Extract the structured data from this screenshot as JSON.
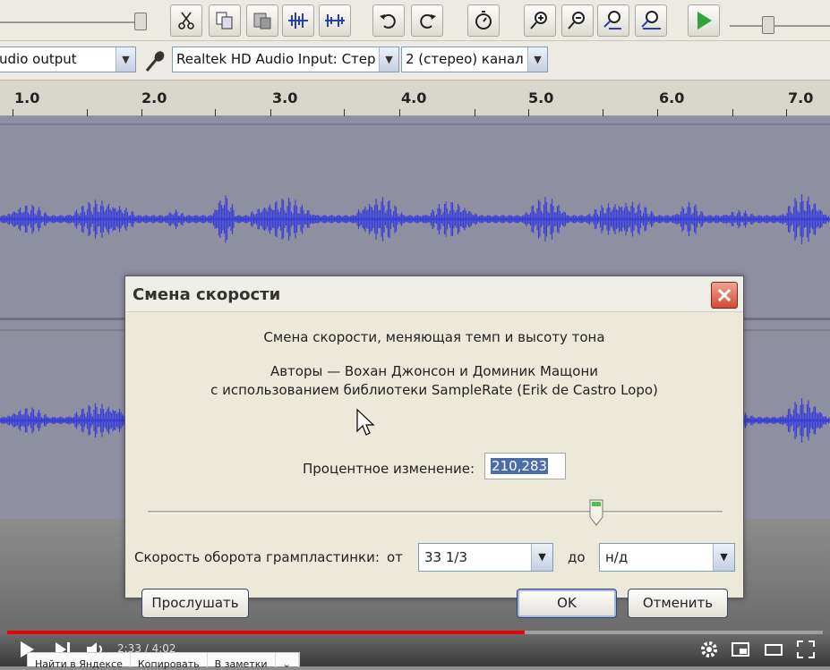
{
  "device_bar": {
    "output_device": "udio output",
    "input_device": "Realtek HD Audio Input: Стер",
    "channels": "2 (стерео) канал"
  },
  "ruler": {
    "labels": [
      "1.0",
      "2.0",
      "3.0",
      "4.0",
      "5.0",
      "6.0",
      "7.0"
    ]
  },
  "dialog": {
    "title": "Смена скорости",
    "description": "Смена скорости, меняющая темп и высоту тона",
    "authors_line1": "Авторы — Вохан Джонсон и Доминик Мащони",
    "authors_line2": "с использованием библиотеки SampleRate (Erik de Castro Lopo)",
    "percent_label": "Процентное изменение:",
    "percent_value": "210,283",
    "slider_level": 0.78,
    "rpm_label": "Скорость оборота грампластинки:",
    "from_label": "от",
    "from_value": "33 1/3",
    "to_label": "до",
    "to_value": "н/д",
    "preview_button": "Прослушать",
    "ok_button": "OK",
    "cancel_button": "Отменить"
  },
  "player": {
    "time": "2:33 / 4:02",
    "progress": 0.635,
    "progress_color": "#ee0000"
  },
  "context_menu": {
    "items": [
      "Найти в Яндексе",
      "Копировать",
      "В заметки"
    ]
  },
  "colors": {
    "waveform": "#3a3fd6",
    "track_bg": "#8f8fa2",
    "dialog_bg": "#ece9d8"
  }
}
